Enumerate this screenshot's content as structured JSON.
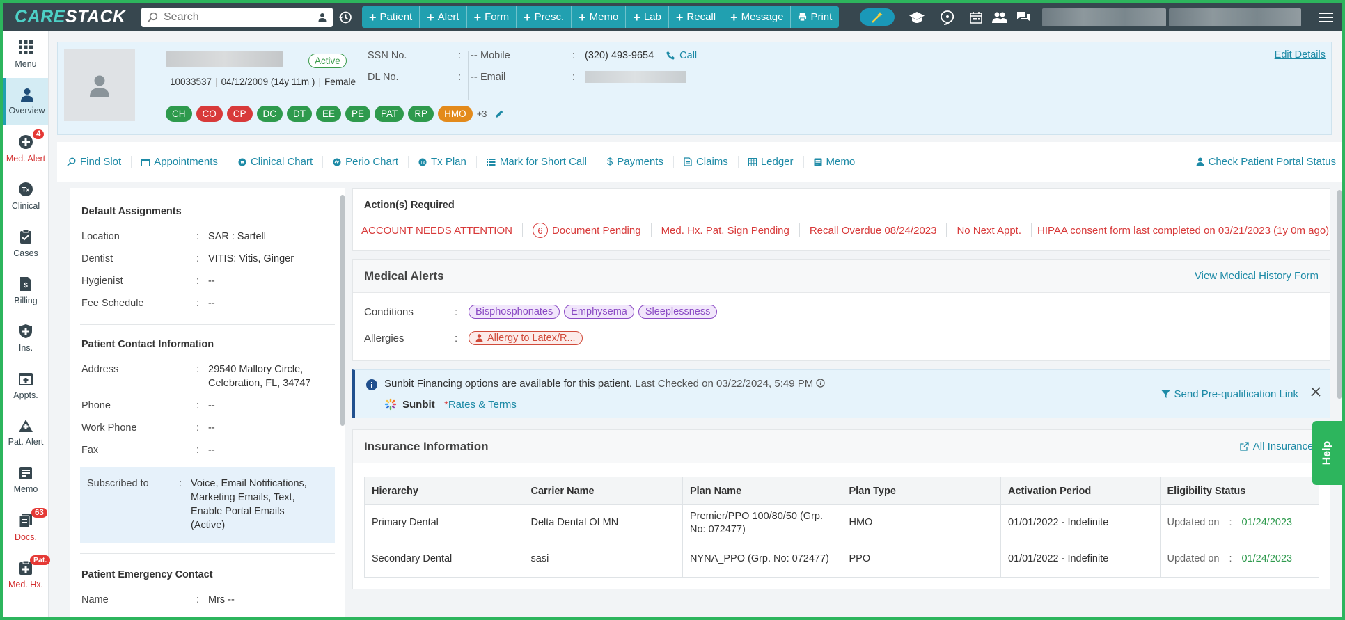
{
  "app": {
    "logo_a": "CARE",
    "logo_b": "STACK"
  },
  "topbar": {
    "search_placeholder": "Search",
    "quick_actions": [
      "Patient",
      "Alert",
      "Form",
      "Presc.",
      "Memo",
      "Lab",
      "Recall",
      "Message"
    ],
    "print_label": "Print"
  },
  "nav": {
    "menu": "Menu",
    "overview": "Overview",
    "med_alert": "Med. Alert",
    "med_alert_badge": "4",
    "clinical": "Clinical",
    "cases": "Cases",
    "billing": "Billing",
    "ins": "Ins.",
    "appts": "Appts.",
    "pat_alert": "Pat. Alert",
    "memo": "Memo",
    "docs": "Docs.",
    "docs_badge": "63",
    "med_hx": "Med. Hx.",
    "med_hx_badge": "Pat."
  },
  "patient": {
    "status": "Active",
    "id": "10033537",
    "dob": "04/12/2009 (14y 11m )",
    "gender": "Female",
    "ssn_label": "SSN No.",
    "ssn_value": "--",
    "dl_label": "DL No.",
    "dl_value": "--",
    "mobile_label": "Mobile",
    "mobile_value": "(320) 493-9654",
    "call_label": "Call",
    "email_label": "Email",
    "edit_label": "Edit Details",
    "tags": [
      {
        "text": "CH",
        "color": "#2e9a4d"
      },
      {
        "text": "CO",
        "color": "#d83a3a"
      },
      {
        "text": "CP",
        "color": "#d83a3a"
      },
      {
        "text": "DC",
        "color": "#2e9a4d"
      },
      {
        "text": "DT",
        "color": "#2e9a4d"
      },
      {
        "text": "EE",
        "color": "#2e9a4d"
      },
      {
        "text": "PE",
        "color": "#2e9a4d"
      },
      {
        "text": "PAT",
        "color": "#2e9a4d"
      },
      {
        "text": "RP",
        "color": "#2e9a4d"
      },
      {
        "text": "HMO",
        "color": "#e38a1b"
      }
    ],
    "more_tags": "+3"
  },
  "tabs": {
    "find_slot": "Find Slot",
    "appointments": "Appointments",
    "clinical_chart": "Clinical Chart",
    "perio_chart": "Perio Chart",
    "tx_plan": "Tx Plan",
    "short_call": "Mark for Short Call",
    "payments": "Payments",
    "claims": "Claims",
    "ledger": "Ledger",
    "memo": "Memo",
    "portal_status": "Check Patient Portal Status"
  },
  "left": {
    "default_title": "Default Assignments",
    "location_k": "Location",
    "location_v": "SAR : Sartell",
    "dentist_k": "Dentist",
    "dentist_v": "VITIS: Vitis, Ginger",
    "hygienist_k": "Hygienist",
    "hygienist_v": "--",
    "fee_k": "Fee Schedule",
    "fee_v": "--",
    "contact_title": "Patient Contact Information",
    "address_k": "Address",
    "address_v": "29540 Mallory Circle, Celebration, FL, 34747",
    "phone_k": "Phone",
    "phone_v": "--",
    "work_k": "Work Phone",
    "work_v": "--",
    "fax_k": "Fax",
    "fax_v": "--",
    "sub_k": "Subscribed to",
    "sub_v": "Voice, Email Notifications, Marketing Emails, Text, Enable Portal Emails (Active)",
    "emergency_title": "Patient Emergency Contact",
    "name_k": "Name",
    "name_v": "Mrs --"
  },
  "actions": {
    "title": "Action(s) Required",
    "account": "ACCOUNT NEEDS ATTENTION",
    "doc_count": "6",
    "doc_pending": "Document Pending",
    "medhx": "Med. Hx. Pat. Sign Pending",
    "recall": "Recall Overdue 08/24/2023",
    "next_appt": "No Next Appt.",
    "hipaa": "HIPAA consent form last completed on 03/21/2023 (1y 0m ago)"
  },
  "medical": {
    "title": "Medical Alerts",
    "link": "View Medical History Form",
    "conditions_k": "Conditions",
    "conditions": [
      "Bisphosphonates",
      "Emphysema",
      "Sleeplessness"
    ],
    "allergies_k": "Allergies",
    "allergy": "Allergy to Latex/R..."
  },
  "sunbit": {
    "msg": "Sunbit Financing options are available for this patient.",
    "checked": "Last Checked on 03/22/2024, 5:49 PM",
    "brand": "Sunbit",
    "star": "*",
    "rates": "Rates & Terms",
    "send": "Send Pre-qualification Link"
  },
  "insurance": {
    "title": "Insurance Information",
    "link": "All Insurances",
    "headers": [
      "Hierarchy",
      "Carrier Name",
      "Plan Name",
      "Plan Type",
      "Activation Period",
      "Eligibility Status"
    ],
    "rows": [
      {
        "hierarchy": "Primary Dental",
        "carrier": "Delta Dental Of MN",
        "plan": "Premier/PPO 100/80/50 (Grp. No: 072477)",
        "type": "HMO",
        "period": "01/01/2022 - Indefinite",
        "elig_label": "Updated on",
        "elig_date": "01/24/2023"
      },
      {
        "hierarchy": "Secondary Dental",
        "carrier": "sasi",
        "plan": "NYNA_PPO (Grp. No: 072477)",
        "type": "PPO",
        "period": "01/01/2022 - Indefinite",
        "elig_label": "Updated on",
        "elig_date": "01/24/2023"
      }
    ]
  },
  "help": "Help"
}
